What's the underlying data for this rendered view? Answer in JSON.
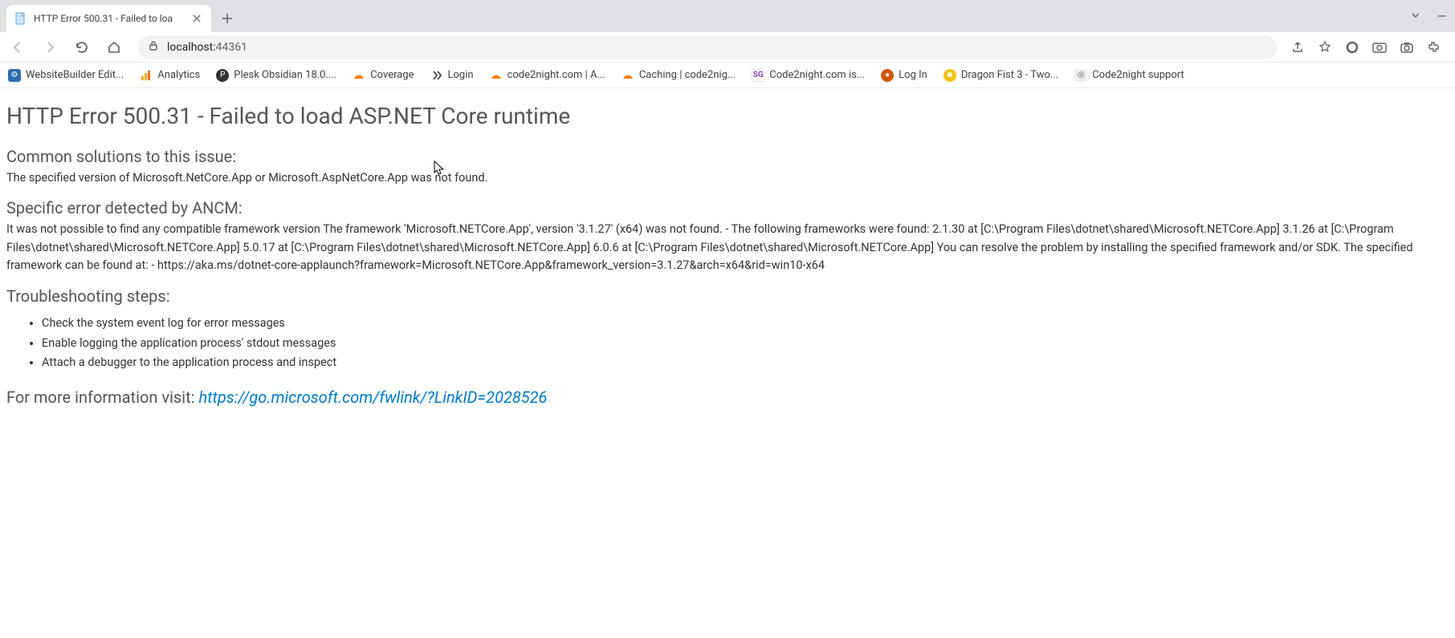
{
  "tab": {
    "title": "HTTP Error 500.31 - Failed to loa"
  },
  "address": {
    "host": "localhost:",
    "port": "44361"
  },
  "bookmarks": [
    {
      "label": "WebsiteBuilder Edit...",
      "color": "#2b6cb0"
    },
    {
      "label": "Analytics",
      "color": "#f6a821"
    },
    {
      "label": "Plesk Obsidian 18.0....",
      "color": "#333"
    },
    {
      "label": "Coverage",
      "color": "#f57c00"
    },
    {
      "label": "Login",
      "color": "#444"
    },
    {
      "label": "code2night.com | A...",
      "color": "#f57c00"
    },
    {
      "label": "Caching | code2nig...",
      "color": "#f57c00"
    },
    {
      "label": "Code2night.com is...",
      "color": "#8e44ad"
    },
    {
      "label": "Log In",
      "color": "#d35400"
    },
    {
      "label": "Dragon Fist 3 - Two...",
      "color": "#f1c40f"
    },
    {
      "label": "Code2night support",
      "color": "#666"
    }
  ],
  "error": {
    "heading": "HTTP Error 500.31 - Failed to load ASP.NET Core runtime",
    "common_heading": "Common solutions to this issue:",
    "common_text": "The specified version of Microsoft.NetCore.App or Microsoft.AspNetCore.App was not found.",
    "specific_heading": "Specific error detected by ANCM:",
    "specific_text": "It was not possible to find any compatible framework version The framework 'Microsoft.NETCore.App', version '3.1.27' (x64) was not found. - The following frameworks were found: 2.1.30 at [C:\\Program Files\\dotnet\\shared\\Microsoft.NETCore.App] 3.1.26 at [C:\\Program Files\\dotnet\\shared\\Microsoft.NETCore.App] 5.0.17 at [C:\\Program Files\\dotnet\\shared\\Microsoft.NETCore.App] 6.0.6 at [C:\\Program Files\\dotnet\\shared\\Microsoft.NETCore.App] You can resolve the problem by installing the specified framework and/or SDK. The specified framework can be found at: - https://aka.ms/dotnet-core-applaunch?framework=Microsoft.NETCore.App&framework_version=3.1.27&arch=x64&rid=win10-x64",
    "troubleshooting_heading": "Troubleshooting steps:",
    "troubleshooting_steps": [
      "Check the system event log for error messages",
      "Enable logging the application process' stdout messages",
      "Attach a debugger to the application process and inspect"
    ],
    "more_info_label": "For more information visit: ",
    "more_info_url": "https://go.microsoft.com/fwlink/?LinkID=2028526"
  }
}
